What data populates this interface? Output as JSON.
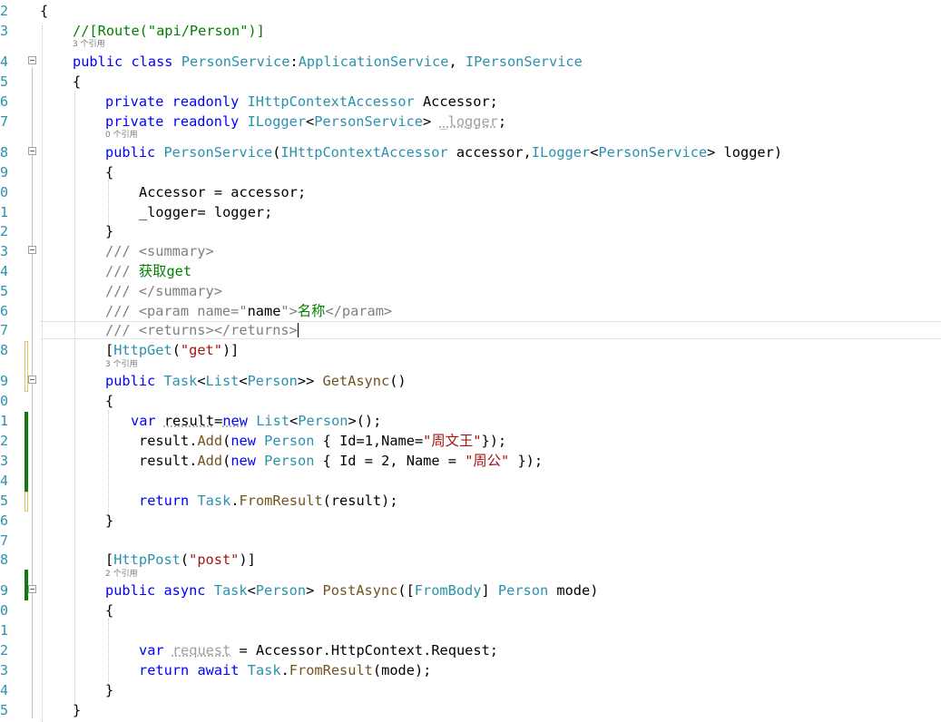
{
  "editor": {
    "line_numbers": [
      "2",
      "3",
      "4",
      "5",
      "6",
      "7",
      "8",
      "9",
      "0",
      "1",
      "2",
      "3",
      "4",
      "5",
      "6",
      "7",
      "8",
      "9",
      "0",
      "1",
      "2",
      "3",
      "4",
      "5",
      "6",
      "7",
      "8",
      "9",
      "0",
      "1",
      "2",
      "3",
      "4",
      "5"
    ],
    "code_lines": [
      "{",
      "//[Route(\"api/Person\")]",
      "public class PersonService:ApplicationService, IPersonService",
      "{",
      "private readonly IHttpContextAccessor Accessor;",
      "private readonly ILogger<PersonService> _logger;",
      "public PersonService(IHttpContextAccessor accessor,ILogger<PersonService> logger)",
      "{",
      "Accessor = accessor;",
      "_logger= logger;",
      "}",
      "/// <summary>",
      "/// 获取get",
      "/// </summary>",
      "/// <param name=\"name\">名称</param>",
      "/// <returns></returns>",
      "[HttpGet(\"get\")]",
      "public Task<List<Person>> GetAsync()",
      "{",
      "var result=new List<Person>();",
      "result.Add(new Person { Id=1,Name=\"周文王\"});",
      "result.Add(new Person { Id = 2, Name = \"周公\" });",
      "",
      "return Task.FromResult(result);",
      "}",
      "",
      "[HttpPost(\"post\")]",
      "public async Task<Person> PostAsync([FromBody] Person mode)",
      "{",
      "",
      "var request = Accessor.HttpContext.Request;",
      "return await Task.FromResult(mode);",
      "}",
      "}"
    ],
    "codelens": {
      "class_refs": "3 个引用",
      "ctor_refs": "0 个引用",
      "get_refs": "3 个引用",
      "post_refs": "2 个引用"
    }
  },
  "colors": {
    "keyword": "#0000ff",
    "type": "#2b91af",
    "string": "#a31515",
    "comment": "#008000",
    "doc_comment": "#808080",
    "line_number": "#2b91af",
    "change_saved": "#107c10",
    "change_unsaved": "#e2c35e"
  }
}
